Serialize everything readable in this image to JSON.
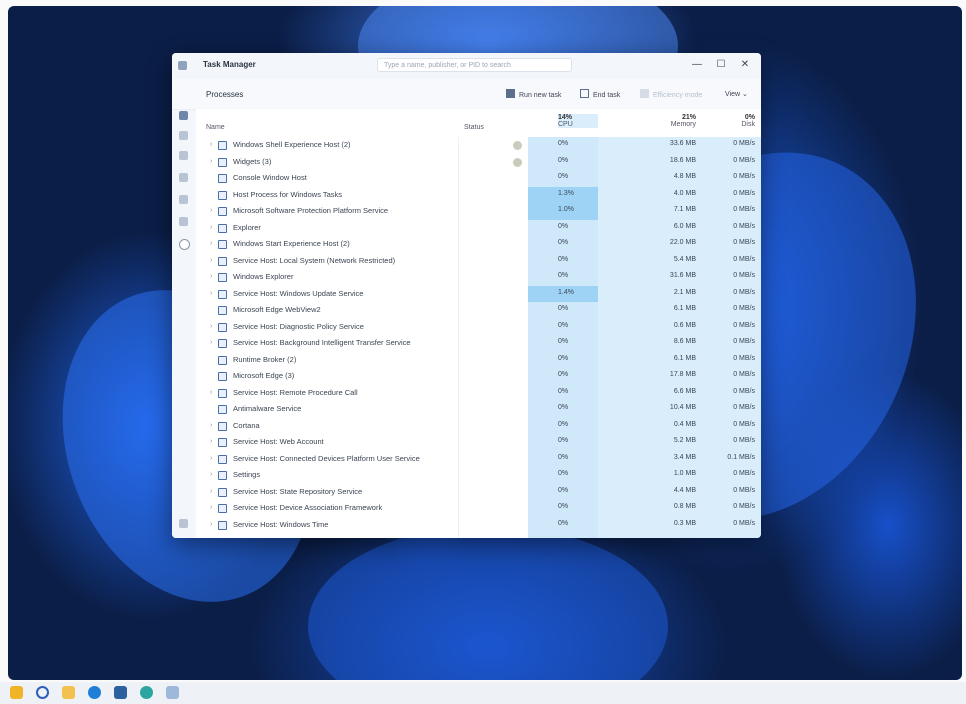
{
  "window": {
    "title": "Task Manager",
    "search_placeholder": "Type a name, publisher, or PID to search",
    "minimize": "—",
    "maximize": "☐",
    "close": "✕"
  },
  "toolbar": {
    "page_title": "Processes",
    "run_new_task": "Run new task",
    "end_task": "End task",
    "efficiency_mode": "Efficiency mode",
    "view": "View"
  },
  "columns": {
    "name": "Name",
    "status": "Status",
    "cpu_pct": "14%",
    "cpu": "CPU",
    "memory_pct": "21%",
    "memory": "Memory",
    "disk_pct": "0%",
    "disk": "Disk"
  },
  "processes": [
    {
      "name": "Windows Shell Experience Host (2)",
      "cpu": "0%",
      "memory": "33.6 MB",
      "disk": "0 MB/s",
      "expandable": true,
      "status": true,
      "hl": false
    },
    {
      "name": "Widgets (3)",
      "cpu": "0%",
      "memory": "18.6 MB",
      "disk": "0 MB/s",
      "expandable": true,
      "status": true,
      "hl": false
    },
    {
      "name": "Console Window Host",
      "cpu": "0%",
      "memory": "4.8 MB",
      "disk": "0 MB/s",
      "expandable": false,
      "status": false,
      "hl": false
    },
    {
      "name": "Host Process for Windows Tasks",
      "cpu": "1.3%",
      "memory": "4.0 MB",
      "disk": "0 MB/s",
      "expandable": false,
      "status": false,
      "hl": true
    },
    {
      "name": "Microsoft Software Protection Platform Service",
      "cpu": "1.0%",
      "memory": "7.1 MB",
      "disk": "0 MB/s",
      "expandable": true,
      "status": false,
      "hl": true
    },
    {
      "name": "Explorer",
      "cpu": "0%",
      "memory": "6.0 MB",
      "disk": "0 MB/s",
      "expandable": true,
      "status": false,
      "hl": false
    },
    {
      "name": "Windows Start Experience Host (2)",
      "cpu": "0%",
      "memory": "22.0 MB",
      "disk": "0 MB/s",
      "expandable": true,
      "status": false,
      "hl": false
    },
    {
      "name": "Service Host: Local System (Network Restricted)",
      "cpu": "0%",
      "memory": "5.4 MB",
      "disk": "0 MB/s",
      "expandable": true,
      "status": false,
      "hl": false
    },
    {
      "name": "Windows Explorer",
      "cpu": "0%",
      "memory": "31.6 MB",
      "disk": "0 MB/s",
      "expandable": true,
      "status": false,
      "hl": false
    },
    {
      "name": "Service Host: Windows Update Service",
      "cpu": "1.4%",
      "memory": "2.1 MB",
      "disk": "0 MB/s",
      "expandable": true,
      "status": false,
      "hl": true
    },
    {
      "name": "Microsoft Edge WebView2",
      "cpu": "0%",
      "memory": "6.1 MB",
      "disk": "0 MB/s",
      "expandable": false,
      "status": false,
      "hl": false
    },
    {
      "name": "Service Host: Diagnostic Policy Service",
      "cpu": "0%",
      "memory": "0.6 MB",
      "disk": "0 MB/s",
      "expandable": true,
      "status": false,
      "hl": false
    },
    {
      "name": "Service Host: Background Intelligent Transfer Service",
      "cpu": "0%",
      "memory": "8.6 MB",
      "disk": "0 MB/s",
      "expandable": true,
      "status": false,
      "hl": false
    },
    {
      "name": "Runtime Broker (2)",
      "cpu": "0%",
      "memory": "6.1 MB",
      "disk": "0 MB/s",
      "expandable": false,
      "status": false,
      "hl": false
    },
    {
      "name": "Microsoft Edge (3)",
      "cpu": "0%",
      "memory": "17.8 MB",
      "disk": "0 MB/s",
      "expandable": false,
      "status": false,
      "hl": false
    },
    {
      "name": "Service Host: Remote Procedure Call",
      "cpu": "0%",
      "memory": "6.6 MB",
      "disk": "0 MB/s",
      "expandable": true,
      "status": false,
      "hl": false
    },
    {
      "name": "Antimalware Service",
      "cpu": "0%",
      "memory": "10.4 MB",
      "disk": "0 MB/s",
      "expandable": false,
      "status": false,
      "hl": false
    },
    {
      "name": "Cortana",
      "cpu": "0%",
      "memory": "0.4 MB",
      "disk": "0 MB/s",
      "expandable": true,
      "status": false,
      "hl": false
    },
    {
      "name": "Service Host: Web Account",
      "cpu": "0%",
      "memory": "5.2 MB",
      "disk": "0 MB/s",
      "expandable": true,
      "status": false,
      "hl": false
    },
    {
      "name": "Service Host: Connected Devices Platform User Service",
      "cpu": "0%",
      "memory": "3.4 MB",
      "disk": "0.1 MB/s",
      "expandable": true,
      "status": false,
      "hl": false
    },
    {
      "name": "Settings",
      "cpu": "0%",
      "memory": "1.0 MB",
      "disk": "0 MB/s",
      "expandable": true,
      "status": false,
      "hl": false
    },
    {
      "name": "Service Host: State Repository Service",
      "cpu": "0%",
      "memory": "4.4 MB",
      "disk": "0 MB/s",
      "expandable": true,
      "status": false,
      "hl": false
    },
    {
      "name": "Service Host: Device Association Framework",
      "cpu": "0%",
      "memory": "0.8 MB",
      "disk": "0 MB/s",
      "expandable": true,
      "status": false,
      "hl": false
    },
    {
      "name": "Service Host: Windows Time",
      "cpu": "0%",
      "memory": "0.3 MB",
      "disk": "0 MB/s",
      "expandable": true,
      "status": false,
      "hl": false
    }
  ],
  "colors": {
    "wallpaper_dark": "#0b1e47",
    "wallpaper_blue": "#1e6cf0",
    "heat_light": "#d9edfb",
    "heat_strong": "#9fd3f5"
  },
  "taskbar": {
    "icons": [
      "start-icon",
      "search-icon",
      "file-explorer-icon",
      "edge-icon",
      "store-icon",
      "edge-beta-icon",
      "task-manager-icon"
    ]
  }
}
